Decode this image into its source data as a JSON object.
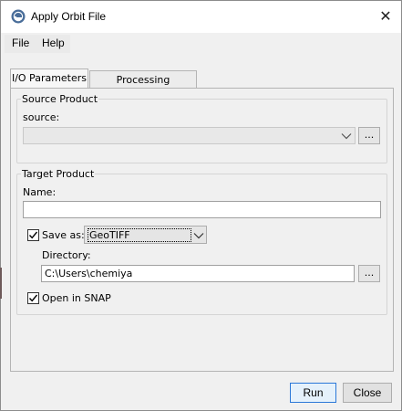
{
  "window": {
    "title": "Apply Orbit File",
    "close_glyph": "✕",
    "app_icon": "snap-app-icon"
  },
  "menu": {
    "items": [
      {
        "label": "File"
      },
      {
        "label": "Help"
      }
    ]
  },
  "tabs": [
    {
      "label": "I/O Parameters",
      "active": true
    },
    {
      "label": "Processing Parameters",
      "active": false
    }
  ],
  "source_product": {
    "group_title": "Source Product",
    "field_label": "source:",
    "value": "",
    "browse_label": "..."
  },
  "target_product": {
    "group_title": "Target Product",
    "name_label": "Name:",
    "name_value": "",
    "save_as_label": "Save as:",
    "save_as_checked": true,
    "format_value": "GeoTIFF",
    "directory_label": "Directory:",
    "directory_value": "C:\\Users\\chemiya",
    "browse_label": "...",
    "open_in_snap_label": "Open in SNAP",
    "open_in_snap_checked": true
  },
  "buttons": {
    "run_label": "Run",
    "close_label": "Close"
  },
  "colors": {
    "accent": "#2b78d8",
    "icon": "#4a6e9a"
  }
}
